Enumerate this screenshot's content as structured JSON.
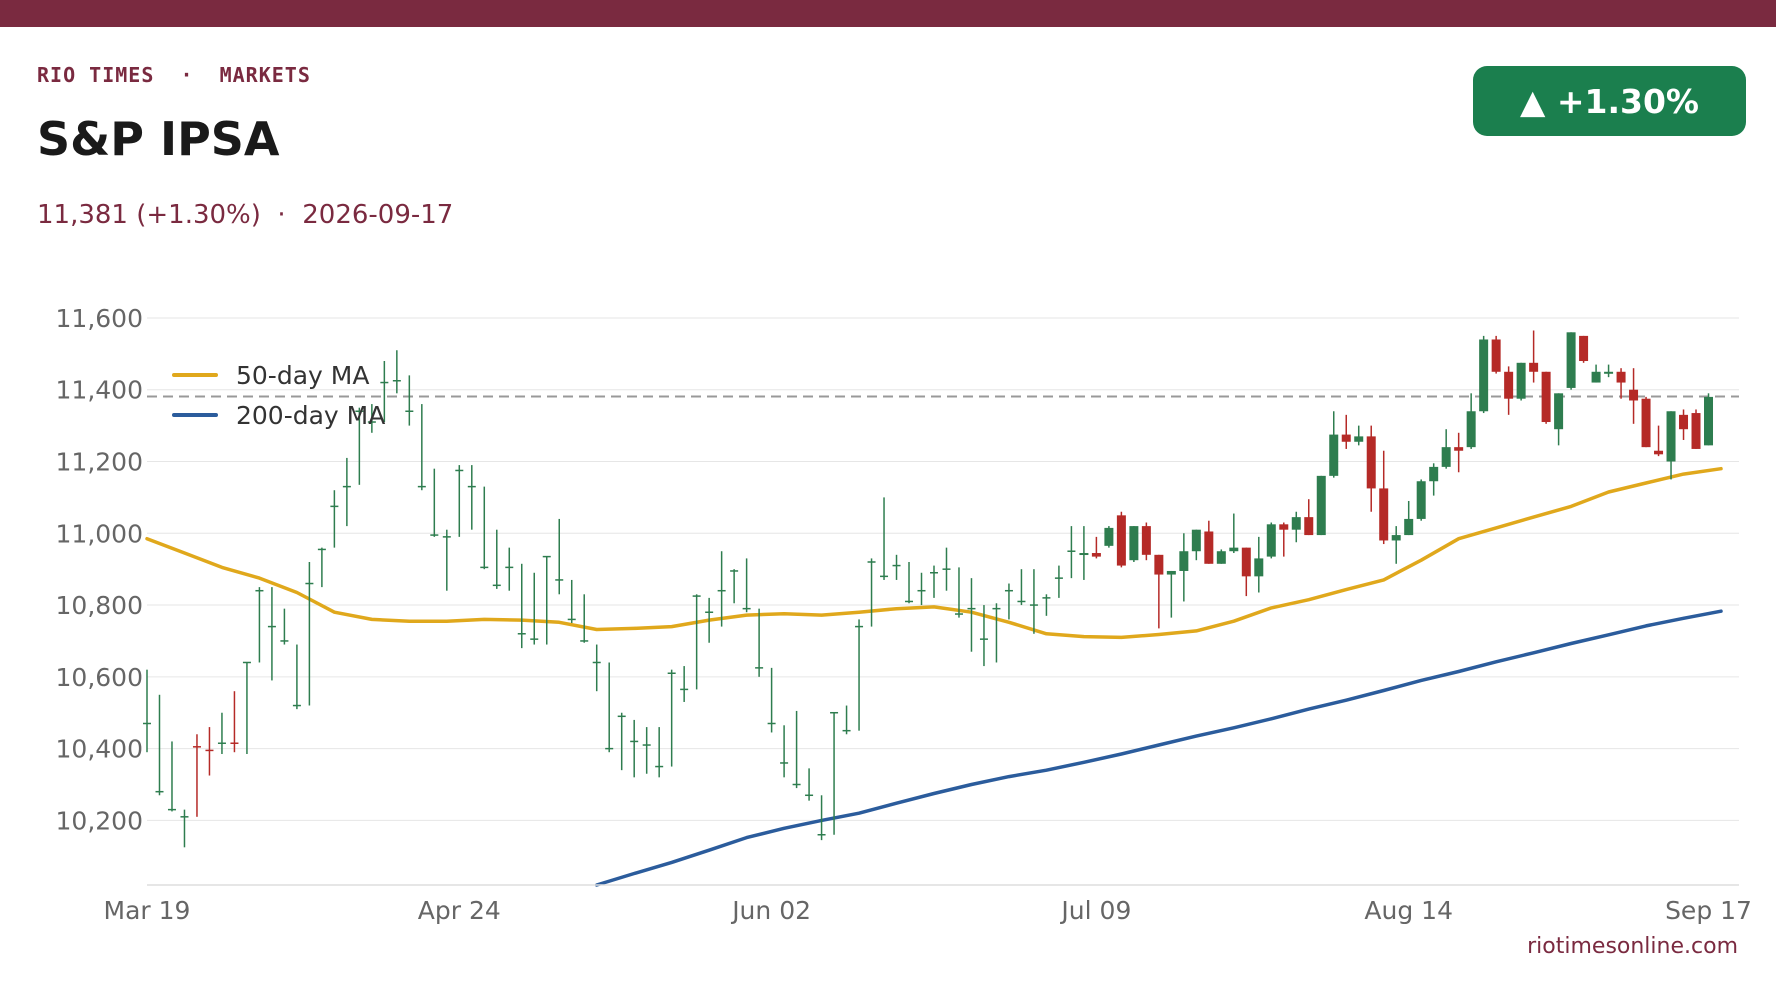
{
  "header": {
    "kicker": "RIO TIMES  ·  MARKETS",
    "title": "S&P IPSA",
    "subtitle": "11,381 (+1.30%)  ·  2026-09-17",
    "badge": "▲ +1.30%"
  },
  "footer": {
    "source": "riotimesonline.com"
  },
  "colors": {
    "brand": "#7a2a40",
    "up": "#2e7d4f",
    "down": "#b52a27",
    "badge": "#1b7f4e",
    "ma50": "#e0a81c",
    "ma200": "#2b5c9c",
    "reference": "#999999",
    "grid": "#e6e6e6"
  },
  "chart_data": {
    "type": "candlestick",
    "xlabel": "",
    "ylabel": "",
    "ylim": [
      10020,
      11650
    ],
    "yticks": [
      10200,
      10400,
      10600,
      10800,
      11000,
      11200,
      11400,
      11600
    ],
    "ytick_labels": [
      "10,200",
      "10,400",
      "10,600",
      "10,800",
      "11,000",
      "11,200",
      "11,400",
      "11,600"
    ],
    "x_count": 127,
    "xticks": [
      {
        "index": 0,
        "label": "Mar 19"
      },
      {
        "index": 25,
        "label": "Apr 24"
      },
      {
        "index": 50,
        "label": "Jun 02"
      },
      {
        "index": 76,
        "label": "Jul 09"
      },
      {
        "index": 101,
        "label": "Aug 14"
      },
      {
        "index": 125,
        "label": "Sep 17"
      }
    ],
    "reference_line": 11381,
    "legend": [
      "50-day MA",
      "200-day MA"
    ],
    "legend_position": "top-left",
    "grid": true,
    "ohlc": [
      [
        10470,
        10620,
        10390,
        10470
      ],
      [
        10280,
        10550,
        10270,
        10280
      ],
      [
        10230,
        10420,
        10225,
        10230
      ],
      [
        10205,
        10230,
        10125,
        10210
      ],
      [
        10410,
        10440,
        10210,
        10405
      ],
      [
        10400,
        10460,
        10325,
        10395
      ],
      [
        10415,
        10500,
        10385,
        10415
      ],
      [
        10420,
        10560,
        10390,
        10415
      ],
      [
        10640,
        10640,
        10385,
        10640
      ],
      [
        10840,
        10850,
        10640,
        10840
      ],
      [
        10740,
        10850,
        10590,
        10740
      ],
      [
        10700,
        10790,
        10690,
        10700
      ],
      [
        10520,
        10690,
        10510,
        10520
      ],
      [
        10860,
        10920,
        10520,
        10860
      ],
      [
        10955,
        10960,
        10850,
        10955
      ],
      [
        11075,
        11120,
        10960,
        11075
      ],
      [
        11130,
        11210,
        11020,
        11130
      ],
      [
        11340,
        11350,
        11135,
        11340
      ],
      [
        11310,
        11360,
        11280,
        11310
      ],
      [
        11420,
        11480,
        11310,
        11420
      ],
      [
        11425,
        11510,
        11390,
        11425
      ],
      [
        11340,
        11440,
        11300,
        11340
      ],
      [
        11130,
        11360,
        11120,
        11130
      ],
      [
        10995,
        11180,
        10990,
        10995
      ],
      [
        10990,
        11010,
        10840,
        10990
      ],
      [
        11175,
        11190,
        10990,
        11175
      ],
      [
        11130,
        11190,
        11010,
        11130
      ],
      [
        10905,
        11130,
        10900,
        10905
      ],
      [
        10855,
        11010,
        10845,
        10855
      ],
      [
        10905,
        10960,
        10840,
        10905
      ],
      [
        10720,
        10915,
        10680,
        10720
      ],
      [
        10705,
        10890,
        10690,
        10705
      ],
      [
        10935,
        10935,
        10690,
        10935
      ],
      [
        10870,
        11040,
        10830,
        10870
      ],
      [
        10760,
        10870,
        10750,
        10760
      ],
      [
        10700,
        10830,
        10695,
        10700
      ],
      [
        10640,
        10690,
        10560,
        10640
      ],
      [
        10400,
        10640,
        10390,
        10400
      ],
      [
        10490,
        10500,
        10340,
        10490
      ],
      [
        10420,
        10480,
        10320,
        10420
      ],
      [
        10410,
        10460,
        10330,
        10410
      ],
      [
        10350,
        10460,
        10320,
        10350
      ],
      [
        10610,
        10620,
        10350,
        10610
      ],
      [
        10565,
        10630,
        10530,
        10565
      ],
      [
        10825,
        10830,
        10565,
        10825
      ],
      [
        10780,
        10820,
        10695,
        10780
      ],
      [
        10840,
        10950,
        10740,
        10840
      ],
      [
        10895,
        10900,
        10805,
        10895
      ],
      [
        10790,
        10930,
        10780,
        10790
      ],
      [
        10625,
        10790,
        10600,
        10625
      ],
      [
        10470,
        10625,
        10445,
        10470
      ],
      [
        10360,
        10465,
        10320,
        10360
      ],
      [
        10300,
        10505,
        10290,
        10300
      ],
      [
        10270,
        10345,
        10255,
        10270
      ],
      [
        10160,
        10270,
        10145,
        10160
      ],
      [
        10500,
        10500,
        10160,
        10500
      ],
      [
        10450,
        10520,
        10440,
        10450
      ],
      [
        10740,
        10760,
        10450,
        10740
      ],
      [
        10920,
        10930,
        10740,
        10920
      ],
      [
        10880,
        11100,
        10870,
        10880
      ],
      [
        10910,
        10940,
        10870,
        10910
      ],
      [
        10810,
        10920,
        10805,
        10810
      ],
      [
        10840,
        10890,
        10800,
        10840
      ],
      [
        10890,
        10910,
        10820,
        10890
      ],
      [
        10900,
        10960,
        10840,
        10900
      ],
      [
        10775,
        10905,
        10765,
        10775
      ],
      [
        10790,
        10875,
        10670,
        10790
      ],
      [
        10705,
        10800,
        10630,
        10705
      ],
      [
        10790,
        10805,
        10640,
        10790
      ],
      [
        10840,
        10860,
        10760,
        10840
      ],
      [
        10810,
        10900,
        10800,
        10810
      ],
      [
        10800,
        10900,
        10720,
        10800
      ],
      [
        10820,
        10830,
        10770,
        10820
      ],
      [
        10875,
        10910,
        10820,
        10875
      ],
      [
        10950,
        11020,
        10875,
        10950
      ],
      [
        10945,
        11020,
        10870,
        10945
      ],
      [
        10945,
        10990,
        10930,
        10935
      ],
      [
        10965,
        11020,
        10960,
        11015
      ],
      [
        11050,
        11060,
        10905,
        10910
      ],
      [
        10925,
        11020,
        10920,
        11020
      ],
      [
        11020,
        11030,
        10925,
        10940
      ],
      [
        10940,
        10940,
        10735,
        10885
      ],
      [
        10885,
        10895,
        10765,
        10895
      ],
      [
        10895,
        11000,
        10810,
        10950
      ],
      [
        10950,
        11010,
        10925,
        11010
      ],
      [
        11005,
        11035,
        10915,
        10915
      ],
      [
        10915,
        10955,
        10915,
        10950
      ],
      [
        10950,
        11055,
        10945,
        10960
      ],
      [
        10960,
        10960,
        10825,
        10880
      ],
      [
        10880,
        10990,
        10835,
        10930
      ],
      [
        10935,
        11030,
        10930,
        11025
      ],
      [
        11025,
        11030,
        10935,
        11010
      ],
      [
        11010,
        11060,
        10975,
        11045
      ],
      [
        11045,
        11095,
        10995,
        10995
      ],
      [
        10995,
        11160,
        10995,
        11160
      ],
      [
        11160,
        11340,
        11155,
        11275
      ],
      [
        11275,
        11330,
        11235,
        11255
      ],
      [
        11255,
        11300,
        11245,
        11270
      ],
      [
        11270,
        11300,
        11060,
        11125
      ],
      [
        11125,
        11230,
        10970,
        10980
      ],
      [
        10980,
        11020,
        10915,
        10995
      ],
      [
        10995,
        11090,
        10995,
        11040
      ],
      [
        11040,
        11150,
        11035,
        11145
      ],
      [
        11145,
        11195,
        11105,
        11185
      ],
      [
        11185,
        11290,
        11180,
        11240
      ],
      [
        11240,
        11280,
        11170,
        11230
      ],
      [
        11240,
        11390,
        11235,
        11340
      ],
      [
        11340,
        11550,
        11335,
        11540
      ],
      [
        11540,
        11550,
        11445,
        11450
      ],
      [
        11450,
        11465,
        11330,
        11375
      ],
      [
        11375,
        11475,
        11370,
        11475
      ],
      [
        11475,
        11565,
        11420,
        11450
      ],
      [
        11450,
        11450,
        11305,
        11310
      ],
      [
        11290,
        11390,
        11245,
        11390
      ],
      [
        11405,
        11560,
        11400,
        11560
      ],
      [
        11550,
        11550,
        11475,
        11480
      ],
      [
        11420,
        11470,
        11420,
        11450
      ],
      [
        11450,
        11470,
        11435,
        11450
      ],
      [
        11450,
        11460,
        11375,
        11420
      ],
      [
        11400,
        11460,
        11305,
        11370
      ],
      [
        11375,
        11380,
        11240,
        11240
      ],
      [
        11230,
        11300,
        11215,
        11220
      ],
      [
        11200,
        11340,
        11150,
        11340
      ],
      [
        11330,
        11345,
        11260,
        11290
      ],
      [
        11335,
        11345,
        11235,
        11235
      ],
      [
        11245,
        11390,
        11245,
        11380
      ]
    ],
    "series": [
      {
        "name": "50-day MA",
        "x": [
          0,
          3,
          6,
          9,
          12,
          15,
          18,
          21,
          24,
          27,
          30,
          33,
          36,
          39,
          42,
          45,
          48,
          51,
          54,
          57,
          60,
          63,
          66,
          69,
          72,
          75,
          78,
          81,
          84,
          87,
          90,
          93,
          96,
          99,
          102,
          105,
          108,
          111,
          114,
          117,
          120,
          123,
          126
        ],
        "values": [
          10985,
          10945,
          10905,
          10875,
          10835,
          10780,
          10760,
          10755,
          10755,
          10760,
          10758,
          10752,
          10732,
          10735,
          10740,
          10758,
          10772,
          10776,
          10772,
          10780,
          10790,
          10795,
          10780,
          10752,
          10720,
          10712,
          10710,
          10718,
          10728,
          10755,
          10792,
          10815,
          10843,
          10870,
          10925,
          10985,
          11015,
          11045,
          11075,
          11115,
          11140,
          11165,
          11180
        ]
      },
      {
        "name": "200-day MA",
        "x": [
          36,
          39,
          42,
          45,
          48,
          51,
          54,
          57,
          60,
          63,
          66,
          69,
          72,
          75,
          78,
          81,
          84,
          87,
          90,
          93,
          96,
          99,
          102,
          105,
          108,
          111,
          114,
          117,
          120,
          123,
          126
        ],
        "values": [
          10020,
          10052,
          10083,
          10117,
          10152,
          10178,
          10200,
          10220,
          10248,
          10275,
          10300,
          10322,
          10340,
          10362,
          10385,
          10410,
          10435,
          10458,
          10483,
          10510,
          10535,
          10562,
          10590,
          10615,
          10642,
          10667,
          10693,
          10717,
          10742,
          10763,
          10783
        ]
      }
    ]
  }
}
